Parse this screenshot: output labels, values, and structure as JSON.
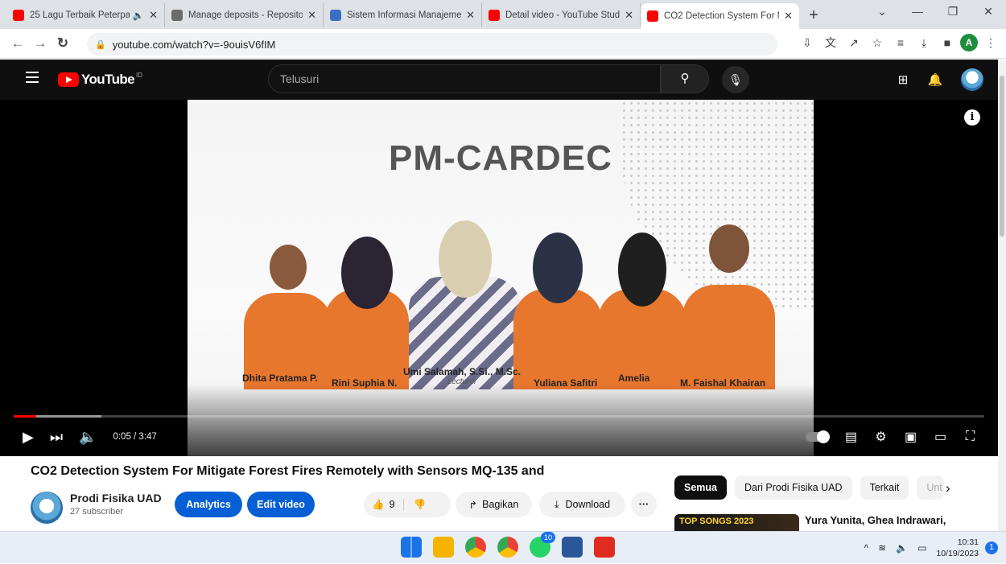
{
  "browser": {
    "tabs": [
      {
        "title": "25 Lagu Terbaik Peterpa",
        "favicon_color": "#ff0000",
        "audio": "🔈",
        "active": false
      },
      {
        "title": "Manage deposits - Reposito",
        "favicon_color": "#6b6b6b",
        "audio": "",
        "active": false
      },
      {
        "title": "Sistem Informasi Manajeme",
        "favicon_color": "#3b6fc4",
        "audio": "",
        "active": false
      },
      {
        "title": "Detail video - YouTube Studi",
        "favicon_color": "#ff0000",
        "audio": "",
        "active": false
      },
      {
        "title": "CO2 Detection System For M",
        "favicon_color": "#ff0000",
        "audio": "",
        "active": true
      }
    ],
    "url": "youtube.com/watch?v=-9ouisV6fIM",
    "profile_initial": "A"
  },
  "youtube": {
    "logo_text": "YouTube",
    "region": "ID",
    "search_placeholder": "Telusuri"
  },
  "video": {
    "slide_title": "PM-CARDEC",
    "people": [
      {
        "name": "Dhita Pratama P.",
        "role": ""
      },
      {
        "name": "Rini Suphia N.",
        "role": ""
      },
      {
        "name": "Umi Salamah, S.Si., M.Sc.",
        "role": "Lecturer"
      },
      {
        "name": "Yuliana Safitri",
        "role": ""
      },
      {
        "name": "Amelia",
        "role": ""
      },
      {
        "name": "M. Faishal Khairan",
        "role": ""
      }
    ],
    "time_display": "0:05 / 3:47",
    "progress_fraction": 0.023,
    "buffered_fraction": 0.09
  },
  "details": {
    "title": "CO2 Detection System For Mitigate Forest Fires Remotely with Sensors MQ-135 and",
    "channel_name": "Prodi Fisika UAD",
    "subscribers": "27 subscriber",
    "analytics_label": "Analytics",
    "edit_label": "Edit video",
    "like_count": "9",
    "share_label": "Bagikan",
    "download_label": "Download",
    "more_label": "···"
  },
  "sidebar": {
    "chips": [
      "Semua",
      "Dari Prodi Fisika UAD",
      "Terkait",
      "Unt"
    ],
    "suggestion_thumb_text": "TOP SONGS 2023",
    "suggestion_title": "Yura Yunita, Ghea Indrawari,"
  },
  "taskbar": {
    "chrome_badge": "10",
    "time": "10:31",
    "date": "10/19/2023",
    "notification_count": "1"
  }
}
